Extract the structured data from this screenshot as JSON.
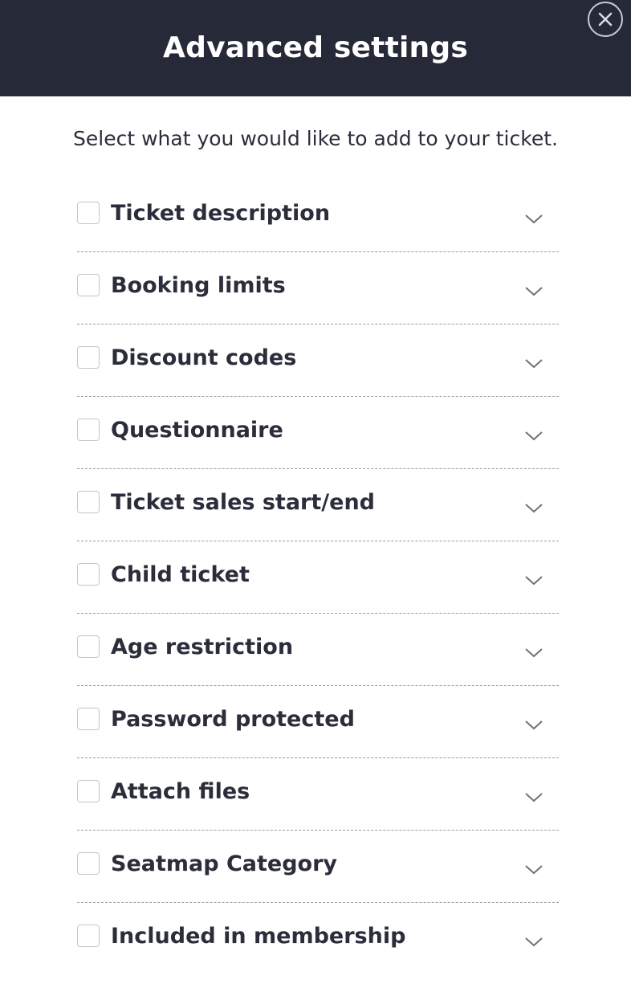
{
  "header": {
    "title": "Advanced settings",
    "close_icon": "close-circle-icon"
  },
  "intro_text": "Select what you would like to add to your ticket.",
  "options": [
    {
      "label": "Ticket description",
      "checked": false
    },
    {
      "label": "Booking limits",
      "checked": false
    },
    {
      "label": "Discount codes",
      "checked": false
    },
    {
      "label": "Questionnaire",
      "checked": false
    },
    {
      "label": "Ticket sales start/end",
      "checked": false
    },
    {
      "label": "Child ticket",
      "checked": false
    },
    {
      "label": "Age restriction",
      "checked": false
    },
    {
      "label": "Password protected",
      "checked": false
    },
    {
      "label": "Attach files",
      "checked": false
    },
    {
      "label": "Seatmap Category",
      "checked": false
    },
    {
      "label": "Included in membership",
      "checked": false
    }
  ],
  "colors": {
    "header_bg": "#262a38",
    "text": "#2b2e3a",
    "divider": "#9a9ca6"
  }
}
